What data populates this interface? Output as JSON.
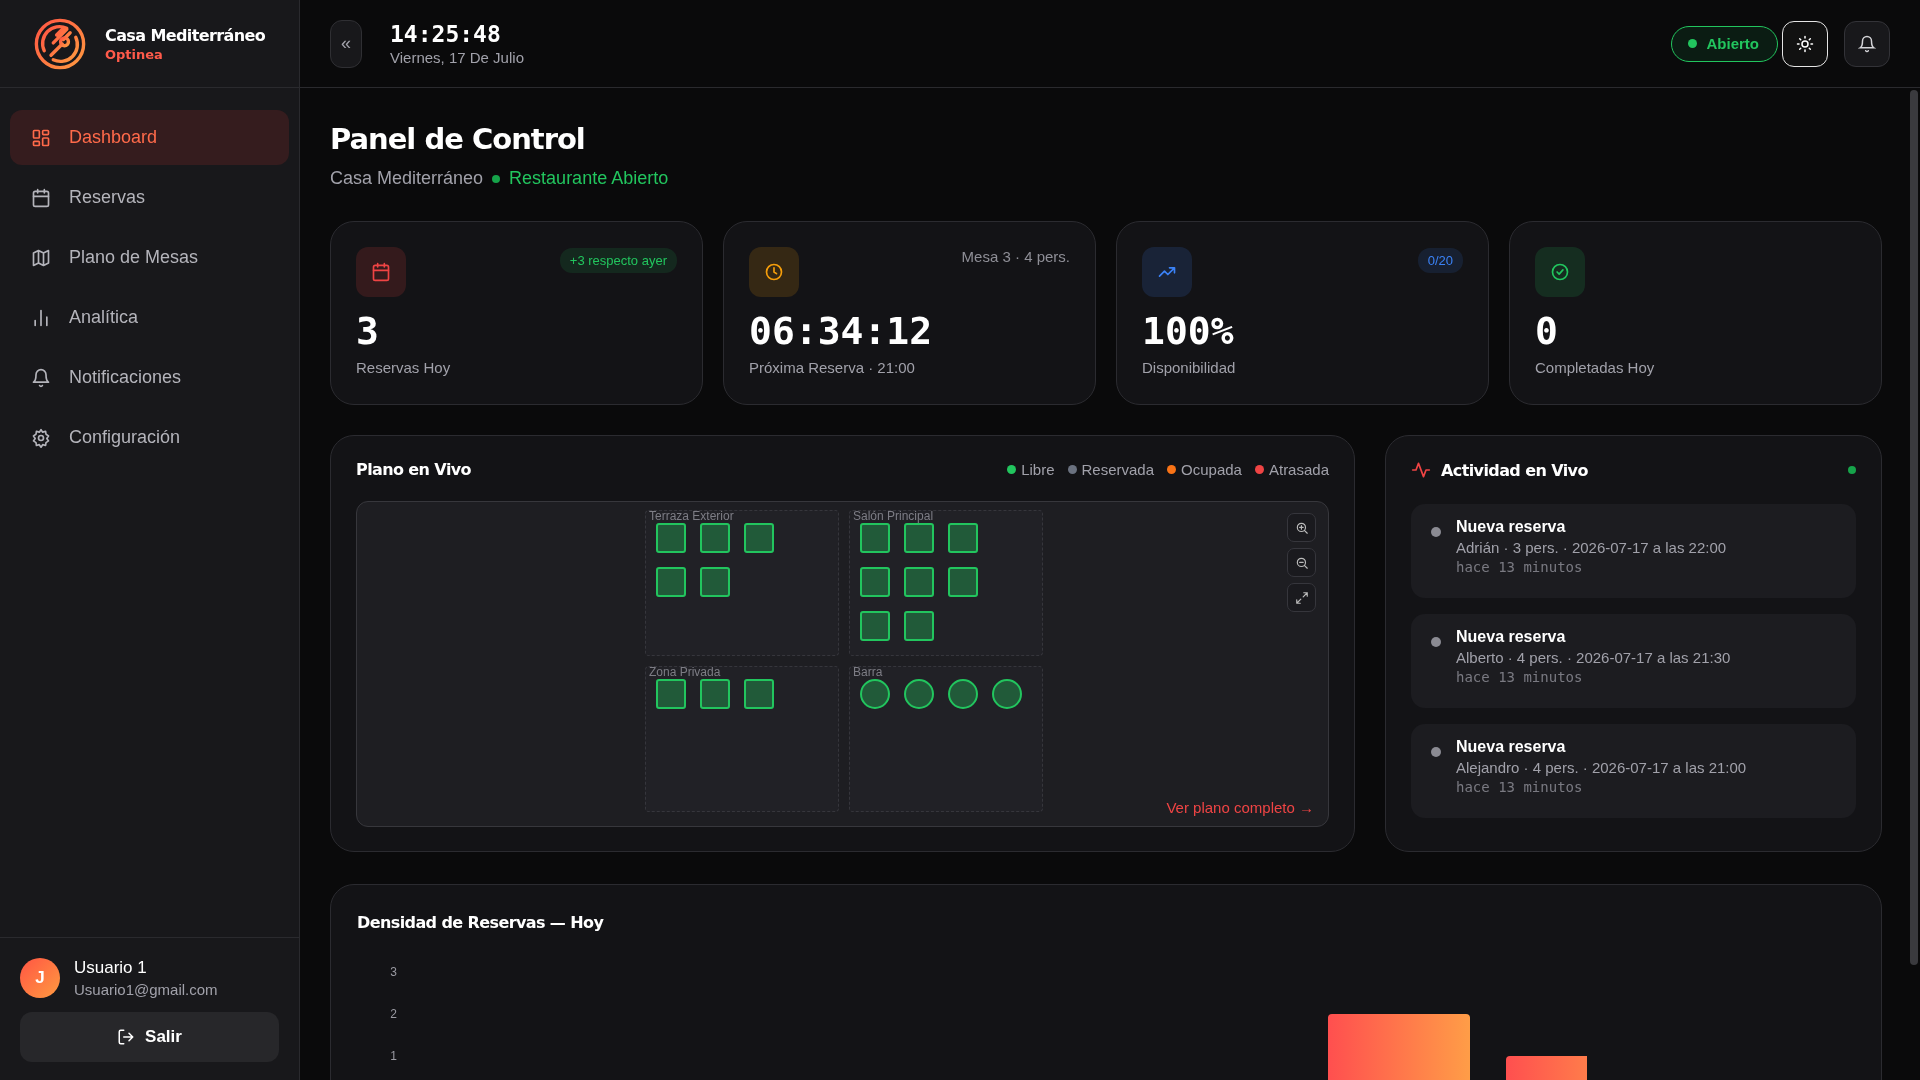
{
  "brand": {
    "name": "Casa Mediterráneo",
    "product": "Optinea"
  },
  "sidebar": {
    "items": [
      {
        "label": "Dashboard",
        "selected": true
      },
      {
        "label": "Reservas",
        "selected": false
      },
      {
        "label": "Plano de Mesas",
        "selected": false
      },
      {
        "label": "Analítica",
        "selected": false
      },
      {
        "label": "Notificaciones",
        "selected": false
      },
      {
        "label": "Configuración",
        "selected": false
      }
    ],
    "user": {
      "initial": "J",
      "name": "Usuario 1",
      "email": "Usuario1@gmail.com"
    },
    "logout": "Salir"
  },
  "header": {
    "collapse": "«",
    "time": "14:25:48",
    "date": "Viernes, 17 De Julio",
    "status": "Abierto"
  },
  "page": {
    "title": "Panel de Control",
    "subtitle": "Casa Mediterráneo",
    "status": "Restaurante Abierto"
  },
  "stats": [
    {
      "color": "#ef4444",
      "badge": {
        "text": "+3 respecto ayer",
        "color": "#22c55e"
      },
      "value": "3",
      "label": "Reservas Hoy"
    },
    {
      "color": "#f59e0b",
      "note": "Mesa 3 · 4 pers.",
      "value": "06:34:12",
      "label": "Próxima Reserva · 21:00"
    },
    {
      "color": "#3b82f6",
      "badge": {
        "text": "0/20",
        "color": "#3b82f6"
      },
      "value": "100%",
      "label": "Disponibilidad"
    },
    {
      "color": "#22c55e",
      "value": "0",
      "label": "Completadas Hoy"
    }
  ],
  "floor": {
    "title": "Plano en Vivo",
    "legend": [
      {
        "label": "Libre",
        "color": "#22c55e"
      },
      {
        "label": "Reservada",
        "color": "#6b7280"
      },
      {
        "label": "Ocupada",
        "color": "#f97316"
      },
      {
        "label": "Atrasada",
        "color": "#ef4444"
      }
    ],
    "zones": [
      {
        "name": "Terraza Exterior",
        "tables": [
          {
            "kind": "square",
            "color": "#22c55e"
          },
          {
            "kind": "square",
            "color": "#22c55e"
          },
          {
            "kind": "square",
            "color": "#22c55e"
          },
          {
            "kind": "square",
            "color": "#22c55e"
          },
          {
            "kind": "square",
            "color": "#22c55e"
          }
        ]
      },
      {
        "name": "Salón Principal",
        "tables": [
          {
            "kind": "square",
            "color": "#22c55e"
          },
          {
            "kind": "square",
            "color": "#22c55e"
          },
          {
            "kind": "square",
            "color": "#22c55e"
          },
          {
            "kind": "square",
            "color": "#22c55e"
          },
          {
            "kind": "square",
            "color": "#22c55e"
          },
          {
            "kind": "square",
            "color": "#22c55e"
          },
          {
            "kind": "square",
            "color": "#22c55e"
          },
          {
            "kind": "square",
            "color": "#22c55e"
          }
        ]
      },
      {
        "name": "Zona Privada",
        "tables": [
          {
            "kind": "square",
            "color": "#22c55e"
          },
          {
            "kind": "square",
            "color": "#22c55e"
          },
          {
            "kind": "square",
            "color": "#22c55e"
          }
        ]
      },
      {
        "name": "Barra",
        "tables": [
          {
            "kind": "round",
            "color": "#22c55e"
          },
          {
            "kind": "round",
            "color": "#22c55e"
          },
          {
            "kind": "round",
            "color": "#22c55e"
          },
          {
            "kind": "round",
            "color": "#22c55e"
          }
        ]
      }
    ],
    "link": "Ver plano completo →"
  },
  "activity": {
    "title": "Actividad en Vivo",
    "items": [
      {
        "title": "Nueva reserva",
        "detail": "Adrián · 3 pers. · 2026-07-17 a las 22:00",
        "time": "hace 13 minutos"
      },
      {
        "title": "Nueva reserva",
        "detail": "Alberto · 4 pers. · 2026-07-17 a las 21:30",
        "time": "hace 13 minutos"
      },
      {
        "title": "Nueva reserva",
        "detail": "Alejandro · 4 pers. · 2026-07-17 a las 21:00",
        "time": "hace 13 minutos"
      }
    ]
  },
  "density": {
    "title": "Densidad de Reservas — Hoy",
    "axis_labels": [
      "3",
      "2",
      "1"
    ]
  }
}
